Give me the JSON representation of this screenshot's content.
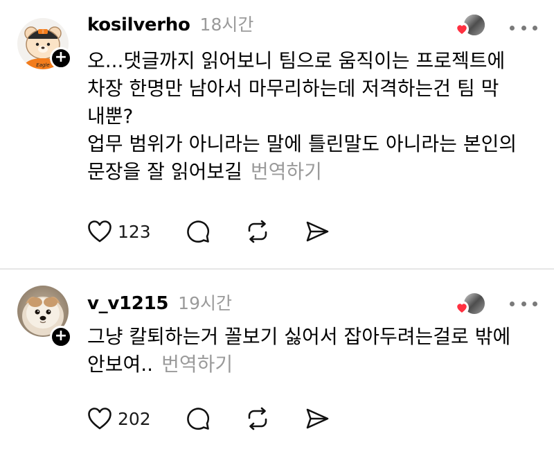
{
  "posts": [
    {
      "username": "kosilverho",
      "time": "18시간",
      "lines": [
        "오...댓글까지 읽어보니 팀으로 움직이는 프로젝트에",
        "차장 한명만 남아서 마무리하는데 저격하는건 팀 막",
        "내뿐?",
        "업무 범위가 아니라는 말에 틀린말도 아니라는 본인의",
        "문장을 잘 읽어보길"
      ],
      "translate_label": "번역하기",
      "like_count": "123",
      "avatar_text": "Eagle",
      "avatar_badge": "Ξ"
    },
    {
      "username": "v_v1215",
      "time": "19시간",
      "lines": [
        "그냥 칼퇴하는거 꼴보기 싫어서 잡아두려는걸로 밖에",
        "안보여.."
      ],
      "translate_label": "번역하기",
      "like_count": "202"
    }
  ],
  "icons": {
    "like": "heart-icon",
    "reply": "comment-icon",
    "repost": "repost-icon",
    "share": "send-icon",
    "more": "more-icon",
    "follow": "plus-icon"
  },
  "colors": {
    "text": "#000000",
    "muted": "#9a9a9a",
    "heart": "#ff3040",
    "divider": "#e6e6e6"
  }
}
